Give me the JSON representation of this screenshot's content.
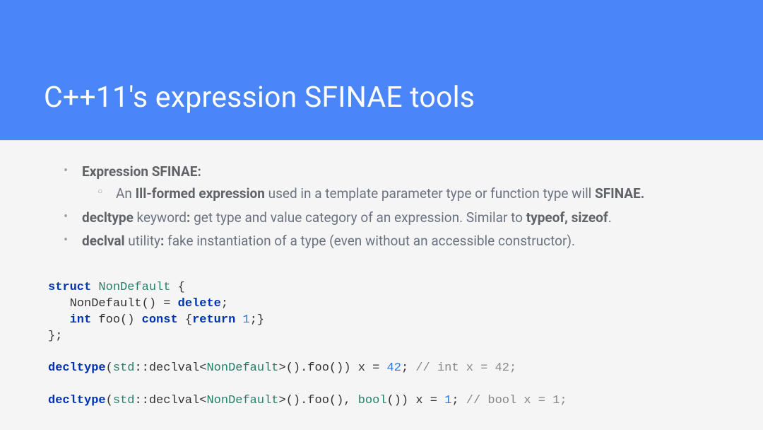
{
  "title": "C++11's expression SFINAE tools",
  "bullets": {
    "b1_label": "Expression SFINAE:",
    "b1a_prefix": "An ",
    "b1a_bold": "Ill-formed expression",
    "b1a_mid": " used in a template parameter type or function type will ",
    "b1a_bold2": "SFINAE.",
    "b2_bold": "decltype",
    "b2_mid": " keyword",
    "b2_colon": ":",
    "b2_rest": " get type and value category of an expression. Similar to ",
    "b2_bold2": "typeof, sizeof",
    "b2_dot": ".",
    "b3_bold": "declval",
    "b3_mid": " utility",
    "b3_colon": ":",
    "b3_rest": " fake instantiation of a type (even without an accessible constructor)."
  },
  "code": {
    "kw_struct": "struct",
    "ty_NonDefault": "NonDefault",
    "brace_open": " {",
    "line2a": "   NonDefault() = ",
    "kw_delete": "delete",
    "semi": ";",
    "line3_indent": "   ",
    "kw_int": "int",
    "line3_mid": " foo() ",
    "kw_const": "const",
    "line3_brace": " {",
    "kw_return": "return",
    "space": " ",
    "num1": "1",
    "line3_end": ";}",
    "brace_close": "};",
    "kw_decltype": "decltype",
    "p_open": "(",
    "ns_std": "std",
    "coloncolon": "::",
    "declval": "declval<",
    "gt_call": ">().foo()) x = ",
    "num42": "42",
    "semi2": "; ",
    "cm1": "// int x = 42;",
    "gt_call2": ">().foo(), ",
    "ty_bool": "bool",
    "call_end": "()) x = ",
    "num1b": "1",
    "semi3": "; ",
    "cm2": "// bool x = 1;"
  }
}
